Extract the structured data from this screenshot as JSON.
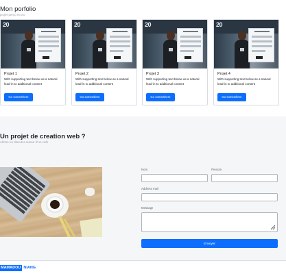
{
  "portfolio": {
    "title": "Mon porfolio",
    "subtitle": "projet perso et pro",
    "cards": [
      {
        "image_text": "20",
        "title": "Projet 1",
        "text": "With supporting text below as a natural lead-in to additional content",
        "button": "Go somewhere"
      },
      {
        "image_text": "20",
        "title": "Projet 2",
        "text": "With supporting text below as a natural lead-in to additional content",
        "button": "Go somewhere"
      },
      {
        "image_text": "20",
        "title": "Projet 3",
        "text": "With supporting text below as a natural lead-in to additional content",
        "button": "Go somewhere"
      },
      {
        "image_text": "20",
        "title": "Projet 4",
        "text": "With supporting text below as a natural lead-in to additional content",
        "button": "Go somewhere"
      }
    ]
  },
  "web_project": {
    "title": "Un projet de creation web ?",
    "subtitle": "Allons en discuter autour d'un cafe",
    "form": {
      "nom_label": "Nom",
      "nom_value": "",
      "prenom_label": "Prenom",
      "prenom_value": "",
      "email_label": "Address mail",
      "email_value": "",
      "message_label": "Message",
      "message_value": "",
      "submit_label": "Envoyer"
    }
  },
  "footer": {
    "logo_part1": "MAMADOU",
    "logo_part2": "NIANG",
    "social_icons": [
      "linkedin-icon",
      "facebook-icon",
      "twitter-icon"
    ]
  },
  "colors": {
    "accent": "#0d6efd",
    "section_bg": "#f5f6f8"
  }
}
